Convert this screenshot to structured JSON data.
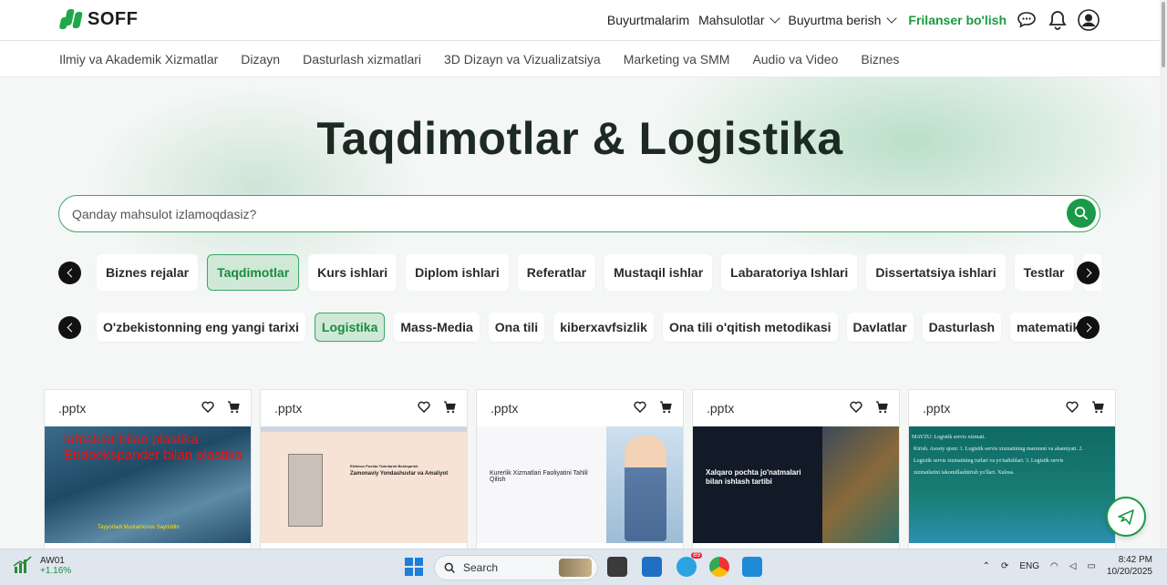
{
  "header": {
    "logo_text": "SOFF",
    "nav": {
      "orders": "Buyurtmalarim",
      "products": "Mahsulotlar",
      "place_order": "Buyurtma berish",
      "freelancer": "Frilanser bo'lish"
    }
  },
  "categories": [
    "Ilmiy va Akademik Xizmatlar",
    "Dizayn",
    "Dasturlash xizmatlari",
    "3D Dizayn va Vizualizatsiya",
    "Marketing va SMM",
    "Audio va Video",
    "Biznes"
  ],
  "hero": {
    "title": "Taqdimotlar & Logistika",
    "search_placeholder": "Qanday mahsulot izlamoqdasiz?"
  },
  "chips_row1": [
    "Biznes rejalar",
    "Taqdimotlar",
    "Kurs ishlari",
    "Diplom ishlari",
    "Referatlar",
    "Mustaqil ishlar",
    "Labaratoriya Ishlari",
    "Dissertatsiya ishlari",
    "Testlar"
  ],
  "chips_row2": [
    "O'zbekistonning eng yangi tarixi",
    "Logistika",
    "Mass-Media",
    "Ona tili",
    "kiberxavfsizlik",
    "Ona tili o'qitish metodikasi",
    "Davlatlar",
    "Dasturlash",
    "matematika"
  ],
  "active_chip_row1": "Taqdimotlar",
  "active_chip_row2": "Logistika",
  "cards": [
    {
      "ext": ".pptx",
      "thumb_title": "lahtaklar bilan plastika Endoekspander bilan plastika",
      "thumb_sub": "Tayyorladi Mustamonov Sayriddin"
    },
    {
      "ext": ".pptx",
      "thumb_title": "Zamonaviy Yondashuvlar va Amaliyot",
      "thumb_sub": "Elektron Pochta Tizimlarini Boshqarish"
    },
    {
      "ext": ".pptx",
      "thumb_title": "Kurerlik Xizmatlari Faoliyatini Tahlil Qilish",
      "thumb_sub": ""
    },
    {
      "ext": ".pptx",
      "thumb_title": "Xalqaro pochta jo'natmalari bilan ishlash tartibi",
      "thumb_sub": ""
    },
    {
      "ext": ".pptx",
      "thumb_title": "MAVZU: Logistik servis xizmati.",
      "thumb_sub": "Kirish. Asosiy qism: 1. Logistik servis xizmatining mazmuni va ahamiyati. 2. Logistik servis xizmatining turlari va yo'nalishlari. 3. Logistik servis xizmatlarini takomillashtirish yo'llari. Xulosa."
    }
  ],
  "taskbar": {
    "stock_name": "AW01",
    "stock_change": "+1.16%",
    "search_label": "Search",
    "telegram_badge": "89",
    "lang": "ENG",
    "time": "8:42 PM",
    "date": "10/20/2025"
  },
  "colors": {
    "accent": "#1a9a48",
    "active_chip_bg": "#cfe9d6",
    "title": "#1d2a24"
  }
}
